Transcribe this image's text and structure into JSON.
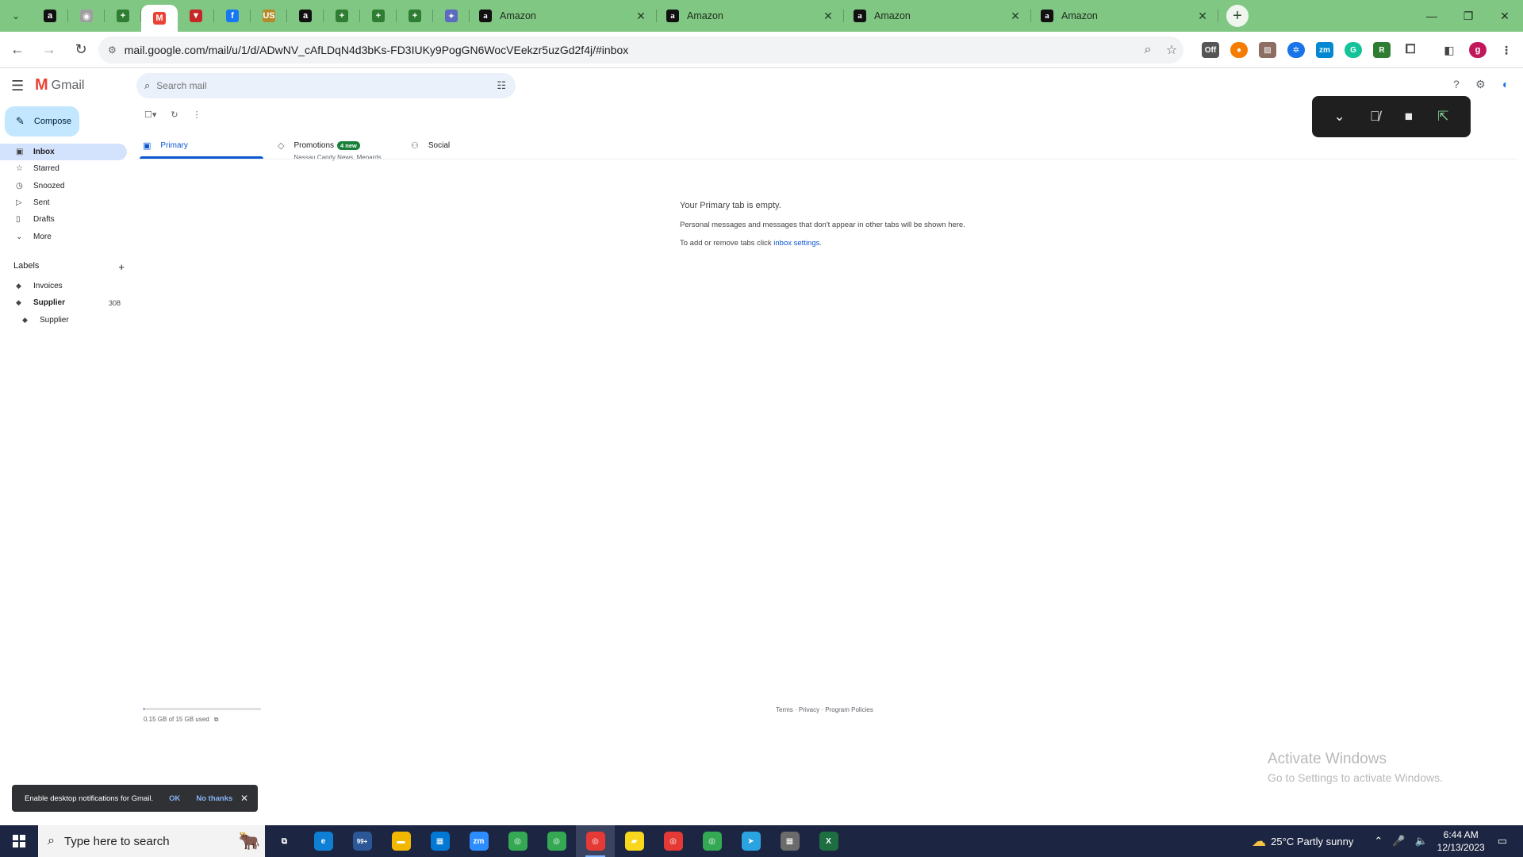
{
  "browser": {
    "pinned_tabs": [
      {
        "icon": "amazon-icon",
        "glyph": "a",
        "color": "#111111"
      },
      {
        "icon": "settings-globe-icon",
        "glyph": "◉",
        "color": "#9e9e9e"
      },
      {
        "icon": "green-plus-icon",
        "glyph": "+",
        "color": "#2e7d32"
      },
      {
        "icon": "gmail-icon",
        "glyph": "M",
        "color": "#ea4335",
        "active": true
      },
      {
        "icon": "tradingview-icon",
        "glyph": "▼",
        "color": "#c62828"
      },
      {
        "icon": "facebook-icon",
        "glyph": "f",
        "color": "#1877f2"
      },
      {
        "icon": "us-app-icon",
        "glyph": "US",
        "color": "#b58a2a"
      },
      {
        "icon": "amazon-icon",
        "glyph": "a",
        "color": "#111111"
      },
      {
        "icon": "green-plus-icon",
        "glyph": "+",
        "color": "#2e7d32"
      },
      {
        "icon": "green-plus-icon",
        "glyph": "+",
        "color": "#2e7d32"
      },
      {
        "icon": "green-plus-icon",
        "glyph": "+",
        "color": "#2e7d32"
      },
      {
        "icon": "colorful-app-icon",
        "glyph": "✦",
        "color": "#5c6bc0"
      }
    ],
    "tabs": [
      {
        "title": "Amazon"
      },
      {
        "title": "Amazon"
      },
      {
        "title": "Amazon"
      },
      {
        "title": "Amazon"
      }
    ],
    "url": "mail.google.com/mail/u/1/d/ADwNV_cAfLDqN4d3bKs-FD3IUKy9PogGN6WocVEekzr5uzGd2f4j/#inbox",
    "profile_initial": "g"
  },
  "gmail": {
    "logo_text": "Gmail",
    "search_placeholder": "Search mail",
    "compose_label": "Compose",
    "nav": [
      {
        "label": "Inbox",
        "icon": "inbox-icon",
        "glyph": "▣",
        "active": true
      },
      {
        "label": "Starred",
        "icon": "star-icon",
        "glyph": "☆"
      },
      {
        "label": "Snoozed",
        "icon": "clock-icon",
        "glyph": "◷"
      },
      {
        "label": "Sent",
        "icon": "send-icon",
        "glyph": "▷"
      },
      {
        "label": "Drafts",
        "icon": "draft-icon",
        "glyph": "▯"
      },
      {
        "label": "More",
        "icon": "chevron-down-icon",
        "glyph": "⌄"
      }
    ],
    "labels_heading": "Labels",
    "labels": [
      {
        "label": "Invoices",
        "count": ""
      },
      {
        "label": "Supplier",
        "count": "308",
        "bold": true
      },
      {
        "label": "Supplier",
        "count": "",
        "nested": true
      }
    ],
    "categories": [
      {
        "label": "Primary",
        "icon": "inbox-icon",
        "active": true
      },
      {
        "label": "Promotions",
        "icon": "tag-icon",
        "badge": "4 new",
        "sub": "Nassau Candy News, Menards..."
      },
      {
        "label": "Social",
        "icon": "people-icon"
      }
    ],
    "empty_title": "Your Primary tab is empty.",
    "empty_line1": "Personal messages and messages that don't appear in other tabs will be shown here.",
    "empty_line2_prefix": "To add or remove tabs click ",
    "empty_line2_link": "inbox settings",
    "empty_line2_suffix": ".",
    "storage_text": "0.15 GB of 15 GB used",
    "storage_fraction": 0.01,
    "footer": "Terms · Privacy · Program Policies",
    "snackbar": {
      "message": "Enable desktop notifications for Gmail.",
      "ok": "OK",
      "no_thanks": "No thanks"
    }
  },
  "activate_windows": {
    "line1": "Activate Windows",
    "line2": "Go to Settings to activate Windows."
  },
  "taskbar": {
    "search_placeholder": "Type here to search",
    "apps": [
      {
        "icon": "task-view-icon",
        "glyph": "⧉",
        "color": "#1c2541"
      },
      {
        "icon": "edge-icon",
        "glyph": "e",
        "color": "#0f7fd6"
      },
      {
        "icon": "mail-app-icon",
        "glyph": "99+",
        "color": "#2b5797"
      },
      {
        "icon": "file-explorer-icon",
        "glyph": "▬",
        "color": "#f2b800"
      },
      {
        "icon": "store-icon",
        "glyph": "▦",
        "color": "#0078d4"
      },
      {
        "icon": "zoom-icon",
        "glyph": "zm",
        "color": "#2d8cff"
      },
      {
        "icon": "chrome-icon",
        "glyph": "◎",
        "color": "#34a853"
      },
      {
        "icon": "chrome-icon",
        "glyph": "◎",
        "color": "#34a853"
      },
      {
        "icon": "chrome-icon",
        "glyph": "◎",
        "color": "#e53935",
        "active": true
      },
      {
        "icon": "sticky-notes-icon",
        "glyph": "▰",
        "color": "#f9d71c"
      },
      {
        "icon": "chrome-icon",
        "glyph": "◎",
        "color": "#e53935"
      },
      {
        "icon": "chrome-icon",
        "glyph": "◎",
        "color": "#34a853"
      },
      {
        "icon": "telegram-icon",
        "glyph": "➤",
        "color": "#2aa3e0"
      },
      {
        "icon": "calculator-icon",
        "glyph": "▦",
        "color": "#6b6b6b"
      },
      {
        "icon": "excel-icon",
        "glyph": "X",
        "color": "#1d6f42"
      }
    ],
    "weather": "25°C  Partly sunny",
    "time": "6:44 AM",
    "date": "12/13/2023"
  }
}
